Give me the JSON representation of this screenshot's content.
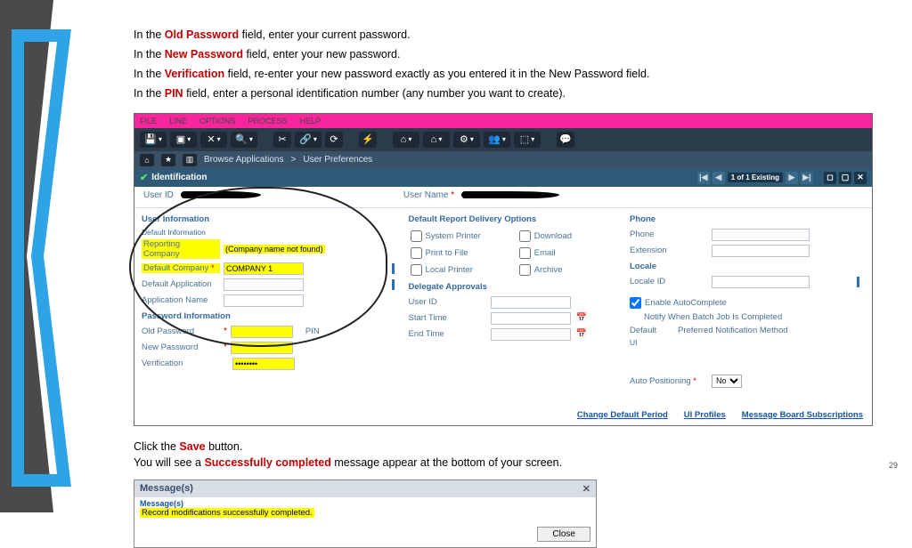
{
  "instructions": {
    "l1a": "In the ",
    "l1b": "Old Password",
    "l1c": " field, enter your current password.",
    "l2a": "In the ",
    "l2b": "New Password",
    "l2c": " field, enter your new password.",
    "l3a": "In the ",
    "l3b": "Verification",
    "l3c": " field, re-enter your new password exactly as you entered it in the New Password field.",
    "l4a": "In the ",
    "l4b": "PIN",
    "l4c": " field, enter a personal identification number (any number you want to create)."
  },
  "menubar": [
    "FILE",
    "LINE",
    "OPTIONS",
    "PROCESS",
    "HELP"
  ],
  "breadcrumb": {
    "a": "Browse Applications",
    "sep": ">",
    "b": "User Preferences"
  },
  "ident": {
    "title": "Identification",
    "counter": "1 of 1 Existing",
    "userid_label": "User ID",
    "username_label": "User Name"
  },
  "userinfo": {
    "title": "User Information",
    "sub": "Default Information",
    "reporting_company_label": "Reporting Company",
    "reporting_company_value": "(Company name not found)",
    "default_company_label": "Default Company",
    "default_company_value": "COMPANY 1",
    "default_application_label": "Default Application",
    "application_name_label": "Application Name"
  },
  "pwd": {
    "title": "Password Information",
    "old_label": "Old Password",
    "new_label": "New Password",
    "ver_label": "Verification",
    "ver_value": "••••••••",
    "pin_label": "PIN"
  },
  "delivery": {
    "title": "Default Report Delivery Options",
    "opts": [
      "System Printer",
      "Download",
      "Print to File",
      "Email",
      "Local Printer",
      "Archive"
    ]
  },
  "delegate": {
    "title": "Delegate Approvals",
    "userid": "User ID",
    "start": "Start Time",
    "end": "End Time"
  },
  "phone": {
    "title": "Phone",
    "phone": "Phone",
    "ext": "Extension"
  },
  "locale": {
    "title": "Locale",
    "id": "Locale ID"
  },
  "autoc": {
    "enable": "Enable AutoComplete",
    "notify": "Notify When Batch Job Is Completed",
    "default": "Default",
    "method": "Preferred Notification Method",
    "ui": "UI"
  },
  "autopos": {
    "label": "Auto Positioning",
    "value": "No"
  },
  "links": [
    "Change Default Period",
    "UI Profiles",
    "Message Board Subscriptions"
  ],
  "lower": {
    "l1a": "Click the ",
    "l1b": "Save",
    "l1c": " button.",
    "l2a": "You will see a ",
    "l2b": "Successfully completed",
    "l2c": " message appear at the bottom of your screen."
  },
  "msg": {
    "title": "Message(s)",
    "sub": "Message(s)",
    "text": "Record modifications successfully completed.",
    "close": "Close"
  },
  "pagenum": "29"
}
